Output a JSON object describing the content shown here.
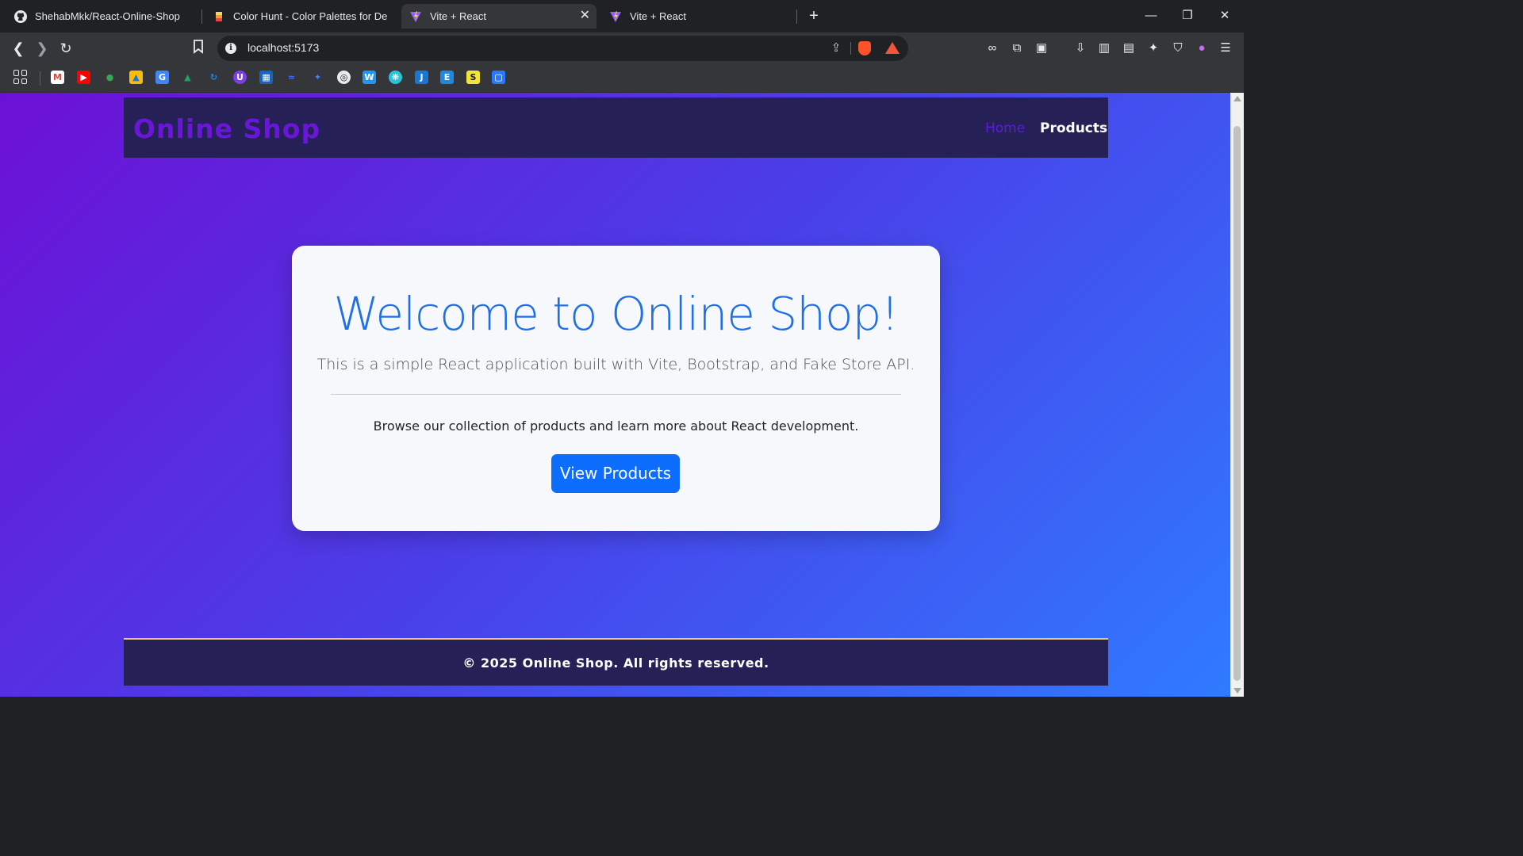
{
  "browser": {
    "tabs": [
      {
        "title": "ShehabMkk/React-Online-Shop",
        "icon": "github-icon",
        "active": false
      },
      {
        "title": "Color Hunt - Color Palettes for Designers",
        "icon": "color-hunt-icon",
        "active": false
      },
      {
        "title": "Vite + React",
        "icon": "vite-icon",
        "active": true
      },
      {
        "title": "Vite + React",
        "icon": "vite-icon",
        "active": false
      }
    ],
    "close_tab_glyph": "✕",
    "new_tab_glyph": "+",
    "window_controls": {
      "minimize": "—",
      "restore": "❐",
      "close": "✕"
    },
    "nav": {
      "back": "❮",
      "forward": "❯",
      "reload": "↻",
      "bookmark": "🔖"
    },
    "address": {
      "url": "localhost:5173",
      "info_glyph": "i",
      "share_glyph": "⇪"
    },
    "extensions": {
      "glasses": "∞",
      "puzzle": "⧉",
      "reader": "▣",
      "downloads": "⇩",
      "sidebar": "▥",
      "wallet": "▤",
      "leo": "✦",
      "vpn": "⛉",
      "profile": "●",
      "menu": "☰"
    },
    "bookmarks": [
      {
        "label": "M",
        "color": "#ea4335",
        "icon": "gmail-icon"
      },
      {
        "label": "▶",
        "color": "#ff0000",
        "icon": "youtube-icon"
      },
      {
        "label": "●",
        "color": "#34a853",
        "icon": "maps-icon"
      },
      {
        "label": "▲",
        "color": "#fbbc04",
        "icon": "photos-icon"
      },
      {
        "label": "G",
        "color": "#4285f4",
        "icon": "translate-icon"
      },
      {
        "label": "▲",
        "color": "#1fa463",
        "icon": "drive-icon"
      },
      {
        "label": "↻",
        "color": "#1e88e5",
        "icon": "sync-icon"
      },
      {
        "label": "U",
        "color": "#7b3fe4",
        "icon": "udemy-icon"
      },
      {
        "label": "▦",
        "color": "#1565c0",
        "icon": "grid-app-icon"
      },
      {
        "label": "≈",
        "color": "#4a6cf7",
        "icon": "wave-icon"
      },
      {
        "label": "✦",
        "color": "#4285f4",
        "icon": "gemini-icon"
      },
      {
        "label": "◎",
        "color": "#e8eaed",
        "icon": "openai-icon"
      },
      {
        "label": "W",
        "color": "#2196f3",
        "icon": "w-icon"
      },
      {
        "label": "❋",
        "color": "#26c6da",
        "icon": "flower-icon"
      },
      {
        "label": "J",
        "color": "#1976d2",
        "icon": "j-icon"
      },
      {
        "label": "E",
        "color": "#1e88e5",
        "icon": "e-icon"
      },
      {
        "label": "S",
        "color": "#f5e23a",
        "icon": "s-icon"
      },
      {
        "label": "▢",
        "color": "#2979ff",
        "icon": "tablet-icon"
      }
    ]
  },
  "site": {
    "brand": "Online Shop",
    "nav": {
      "home": "Home",
      "products": "Products"
    },
    "hero": {
      "title": "Welcome to Online Shop!",
      "lead": "This is a simple React application built with Vite, Bootstrap, and Fake Store API.",
      "body": "Browse our collection of products and learn more about React development.",
      "button": "View Products"
    },
    "footer": "© 2025 Online Shop. All rights reserved."
  },
  "colors": {
    "gradient_start": "#6d10d6",
    "gradient_end": "#2f7bff",
    "nav_bg": "#252156",
    "brand_purple": "#6a16d8",
    "primary": "#0d6efd",
    "title_blue": "#1f6fe8"
  }
}
